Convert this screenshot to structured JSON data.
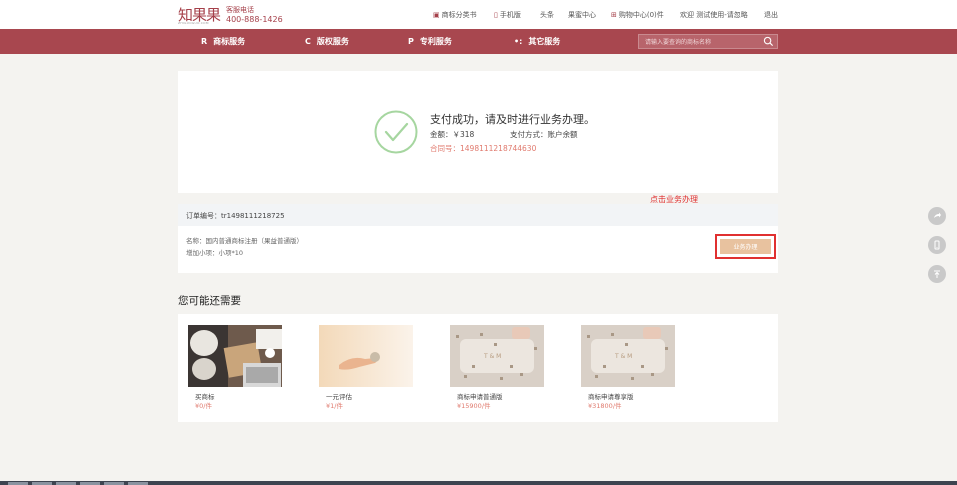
{
  "header": {
    "logo": "知果果",
    "logo_sub": "ZHIGUOGUO.COM",
    "hotline_label": "客服电话",
    "hotline_number": "400-888-1426",
    "links": [
      {
        "icon": "trademark-book-icon",
        "label": "商标分类书"
      },
      {
        "icon": "mobile-icon",
        "label": "手机版"
      },
      {
        "icon": "",
        "label": "头条"
      },
      {
        "icon": "",
        "label": "果蜜中心"
      },
      {
        "icon": "cart-icon",
        "label": "购物中心(0)件"
      },
      {
        "icon": "",
        "label": "欢迎 测试使用-请忽略"
      },
      {
        "icon": "",
        "label": "退出"
      }
    ]
  },
  "nav": {
    "items": [
      {
        "icon": "R",
        "label": "商标服务"
      },
      {
        "icon": "C",
        "label": "版权服务"
      },
      {
        "icon": "P",
        "label": "专利服务"
      },
      {
        "icon": "•:",
        "label": "其它服务"
      }
    ],
    "search_placeholder": "请输入要查询的商标名称"
  },
  "success": {
    "title": "支付成功，请及时进行业务办理。",
    "amount": "金额：￥318",
    "method": "支付方式：账户余额",
    "contract": "合同号：1498111218744630"
  },
  "order": {
    "order_no": "订单编号：tr1498111218725",
    "name": "名称：国内普通商标注册（果益普通版）",
    "extra": "增加小项：小项*10",
    "handle_button": "业务办理",
    "annotation": "点击业务办理"
  },
  "recommend": {
    "title": "您可能还需要",
    "items": [
      {
        "name": "买商标",
        "price": "¥0/件"
      },
      {
        "name": "一元评估",
        "price": "¥1/件"
      },
      {
        "name": "商标申请普通版",
        "price": "¥15900/件"
      },
      {
        "name": "商标申请尊享版",
        "price": "¥31800/件"
      }
    ]
  },
  "colors": {
    "brand": "#a8474f",
    "accent_price": "#e07a6e",
    "button": "#e8c29f",
    "annotation": "#e03030"
  }
}
